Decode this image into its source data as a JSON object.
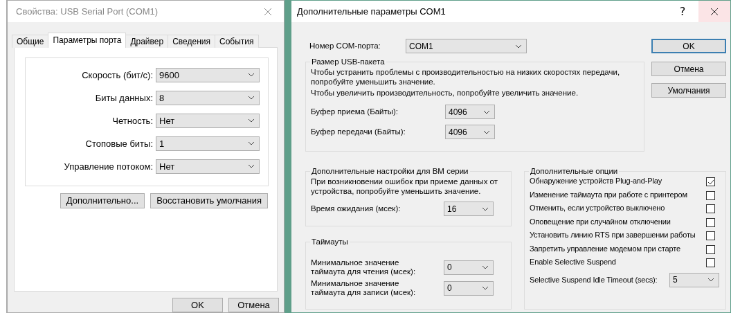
{
  "main_dialog": {
    "title": "Свойства: USB Serial Port (COM1)",
    "tabs": [
      {
        "label": "Общие",
        "selected": false
      },
      {
        "label": "Параметры порта",
        "selected": true
      },
      {
        "label": "Драйвер",
        "selected": false
      },
      {
        "label": "Сведения",
        "selected": false
      },
      {
        "label": "События",
        "selected": false
      }
    ],
    "fields": [
      {
        "label": "Скорость (бит/с):",
        "value": "9600"
      },
      {
        "label": "Биты данных:",
        "value": "8"
      },
      {
        "label": "Четность:",
        "value": "Нет"
      },
      {
        "label": "Стоповые биты:",
        "value": "1"
      },
      {
        "label": "Управление потоком:",
        "value": "Нет"
      }
    ],
    "panel_buttons": [
      "Дополнительно...",
      "Восстановить умолчания"
    ],
    "buttons": [
      "OK",
      "Отмена"
    ]
  },
  "advanced_dialog": {
    "title": "Дополнительные параметры COM1",
    "help": "?",
    "com_port": {
      "label": "Номер COM-порта:",
      "value": "COM1"
    },
    "buttons": [
      {
        "label": "OK",
        "default": true
      },
      {
        "label": "Отмена",
        "default": false
      },
      {
        "label": "Умолчания",
        "default": false
      }
    ],
    "usb_group": {
      "title": "Размер USB-пакета",
      "notes": [
        "Чтобы устранить проблемы с производительностью на низких скоростях передачи, попробуйте уменьшить значение.",
        "Чтобы увеличить производительность, попробуйте увеличить значение."
      ],
      "fields": [
        {
          "label": "Буфер приема (Байты):",
          "value": "4096"
        },
        {
          "label": "Буфер передачи (Байты):",
          "value": "4096"
        }
      ]
    },
    "bm_group": {
      "title": "Дополнительные настройки для BM серии",
      "note": "При возникновении ошибок при приеме данных от устройства, попробуйте уменьшить значение.",
      "fields": [
        {
          "label": "Время ожидания (мсек):",
          "value": "16"
        }
      ]
    },
    "timeouts_group": {
      "title": "Таймауты",
      "fields": [
        {
          "label": "Минимальное значение таймаута для чтения (мсек):",
          "value": "0"
        },
        {
          "label": "Минимальное значение таймаута для записи (мсек):",
          "value": "0"
        }
      ]
    },
    "options_group": {
      "title": "Дополнительные опции",
      "options": [
        {
          "label": "Обнаружение устройств Plug-and-Play",
          "kind": "checkbox",
          "checked": true
        },
        {
          "label": "Изменение таймаута при работе с принтером",
          "kind": "checkbox",
          "checked": false
        },
        {
          "label": "Отменить, если устройство выключено",
          "kind": "checkbox",
          "checked": false
        },
        {
          "label": "Оповещение при случайном отключении",
          "kind": "checkbox",
          "checked": false
        },
        {
          "label": "Установить линию RTS при завершении работы",
          "kind": "checkbox",
          "checked": false
        },
        {
          "label": "Запретить управление модемом при старте",
          "kind": "checkbox",
          "checked": false
        },
        {
          "label": "Enable Selective Suspend",
          "kind": "checkbox",
          "checked": false
        },
        {
          "label": "Selective Suspend Idle Timeout (secs):",
          "kind": "select",
          "value": "5"
        }
      ]
    }
  }
}
